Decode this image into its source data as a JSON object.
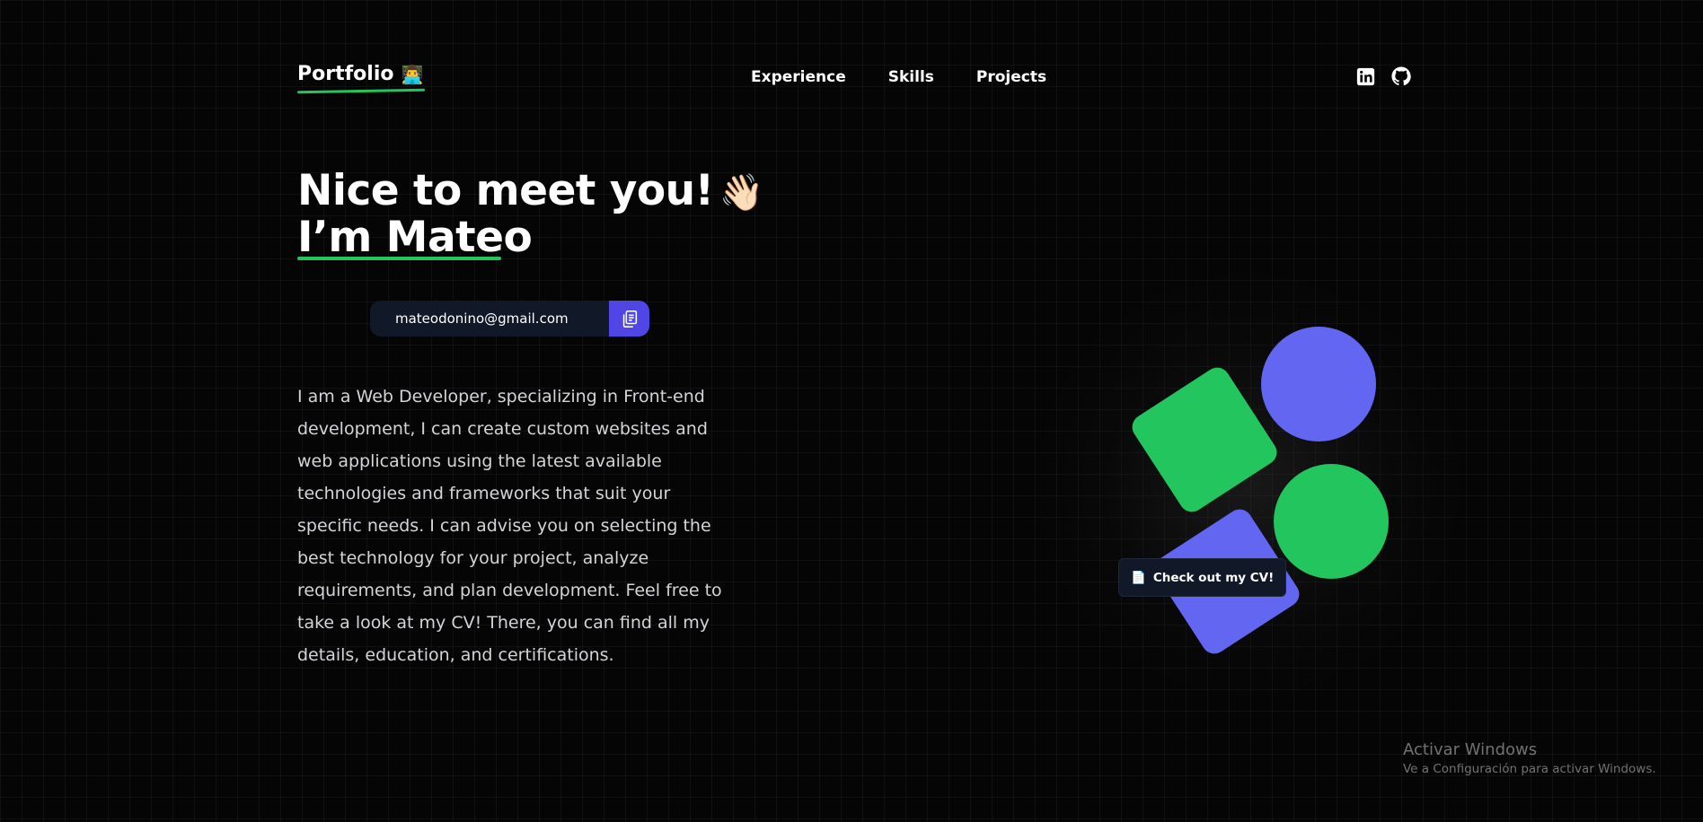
{
  "header": {
    "logo_text": "Portfolio",
    "logo_emoji": "👨‍💻",
    "nav": [
      {
        "label": "Experience"
      },
      {
        "label": "Skills"
      },
      {
        "label": "Projects"
      }
    ],
    "social_icons": [
      "linkedin-icon",
      "github-icon"
    ]
  },
  "hero": {
    "title_line1": "Nice to meet you!",
    "wave_emoji": "👋🏻",
    "title_line2": "I’m Mateo",
    "email": "mateodonino@gmail.com",
    "copy_icon": "copy-icon",
    "description": "I am a Web Developer, specializing in Front-end development, I can create custom websites and web applications using the latest available technologies and frameworks that suit your specific needs. I can advise you on selecting the best technology for your project, analyze requirements, and plan development. Feel free to take a look at my CV! There, you can find all my details, education, and certifications."
  },
  "cv_button": {
    "icon": "📄",
    "label": "Check out my CV!"
  },
  "colors": {
    "background": "#050505",
    "accent_green": "#22c55e",
    "accent_indigo": "#6366f1",
    "copy_button": "#4f46e5",
    "pill_bg": "#111827"
  },
  "watermark": {
    "title": "Activar Windows",
    "subtitle": "Ve a Configuración para activar Windows."
  }
}
